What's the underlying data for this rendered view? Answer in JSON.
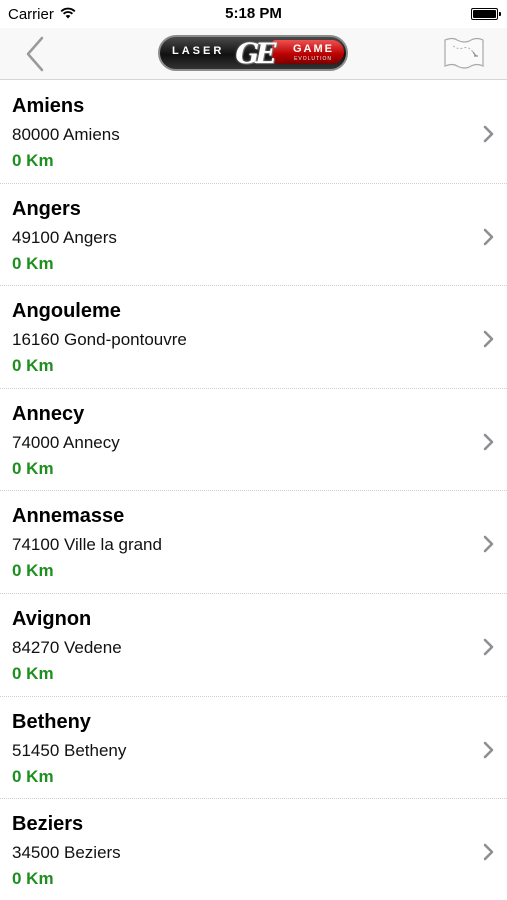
{
  "status_bar": {
    "carrier": "Carrier",
    "time": "5:18 PM"
  },
  "nav": {
    "logo_left": "LASER",
    "logo_center": "GE",
    "logo_right": "GAME",
    "logo_sub": "EVOLUTION"
  },
  "locations": [
    {
      "name": "Amiens",
      "address": "80000 Amiens",
      "distance": "0 Km"
    },
    {
      "name": "Angers",
      "address": "49100 Angers",
      "distance": "0 Km"
    },
    {
      "name": "Angouleme",
      "address": "16160 Gond-pontouvre",
      "distance": "0 Km"
    },
    {
      "name": "Annecy",
      "address": "74000 Annecy",
      "distance": "0 Km"
    },
    {
      "name": "Annemasse",
      "address": "74100 Ville la grand",
      "distance": "0 Km"
    },
    {
      "name": "Avignon",
      "address": "84270 Vedene",
      "distance": "0 Km"
    },
    {
      "name": "Betheny",
      "address": "51450 Betheny",
      "distance": "0 Km"
    },
    {
      "name": "Beziers",
      "address": "34500 Beziers",
      "distance": "0 Km"
    }
  ],
  "colors": {
    "distance": "#1f8f1f",
    "nav_background": "#f8f8f8",
    "chevron": "#8e8e93"
  },
  "icons": {
    "back": "chevron-left-icon",
    "map": "map-icon",
    "disclosure": "chevron-right-icon",
    "wifi": "wifi-icon",
    "battery": "battery-icon"
  }
}
